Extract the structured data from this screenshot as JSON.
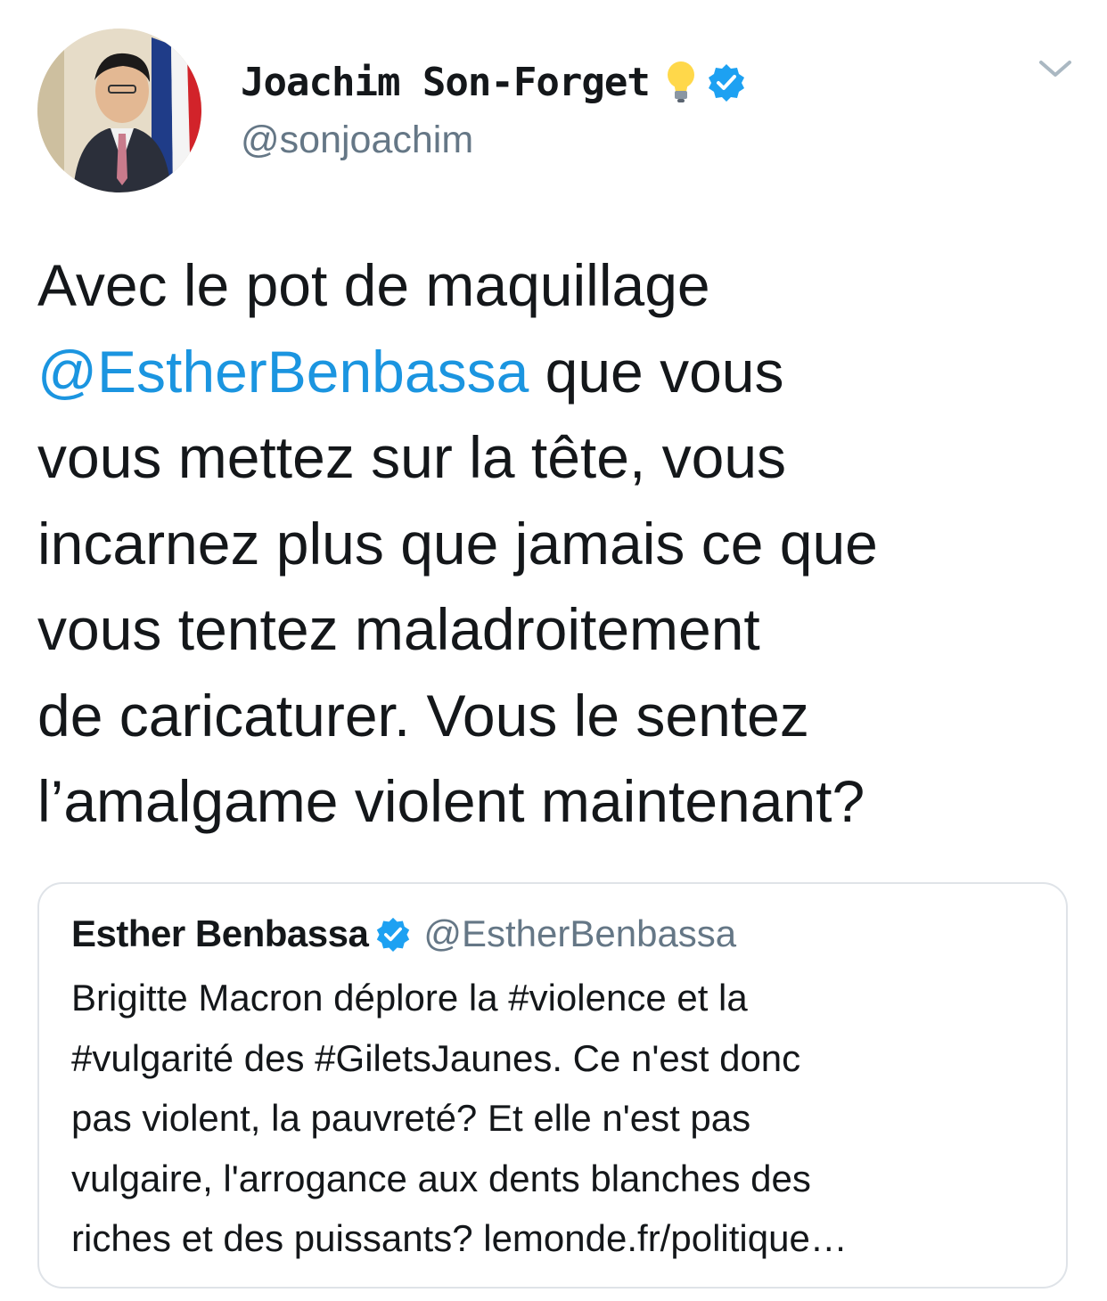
{
  "author": {
    "display_name": "Joachim Son-Forget",
    "handle": "@sonjoachim",
    "emoji_icon": "lightbulb-icon",
    "verified_icon": "verified-badge-icon",
    "verified_color": "#1da1f2"
  },
  "tweet": {
    "lines": [
      {
        "segments": [
          {
            "text": "Avec le pot de maquillage",
            "type": "text"
          }
        ]
      },
      {
        "segments": [
          {
            "text": "@EstherBenbassa",
            "type": "mention"
          },
          {
            "text": " que vous",
            "type": "text"
          }
        ]
      },
      {
        "segments": [
          {
            "text": "vous mettez sur la tête, vous",
            "type": "text"
          }
        ]
      },
      {
        "segments": [
          {
            "text": "incarnez plus que jamais ce que",
            "type": "text"
          }
        ]
      },
      {
        "segments": [
          {
            "text": "vous tentez maladroitement",
            "type": "text"
          }
        ]
      },
      {
        "segments": [
          {
            "text": "de caricaturer. Vous le sentez",
            "type": "text"
          }
        ]
      },
      {
        "segments": [
          {
            "text": "l’amalgame violent maintenant?",
            "type": "text"
          }
        ]
      }
    ],
    "mention_color": "#1b95e0"
  },
  "quoted_tweet": {
    "display_name": "Esther Benbassa",
    "handle": "@EstherBenbassa",
    "verified_icon": "verified-badge-icon",
    "lines": [
      "Brigitte Macron déplore la #violence et la",
      "#vulgarité des #GiletsJaunes. Ce n'est donc",
      "pas violent, la pauvreté?  Et elle n'est pas",
      "vulgaire, l'arrogance aux dents blanches des",
      "riches et des puissants?  lemonde.fr/politique…"
    ]
  },
  "menu_icon": "chevron-down-icon"
}
